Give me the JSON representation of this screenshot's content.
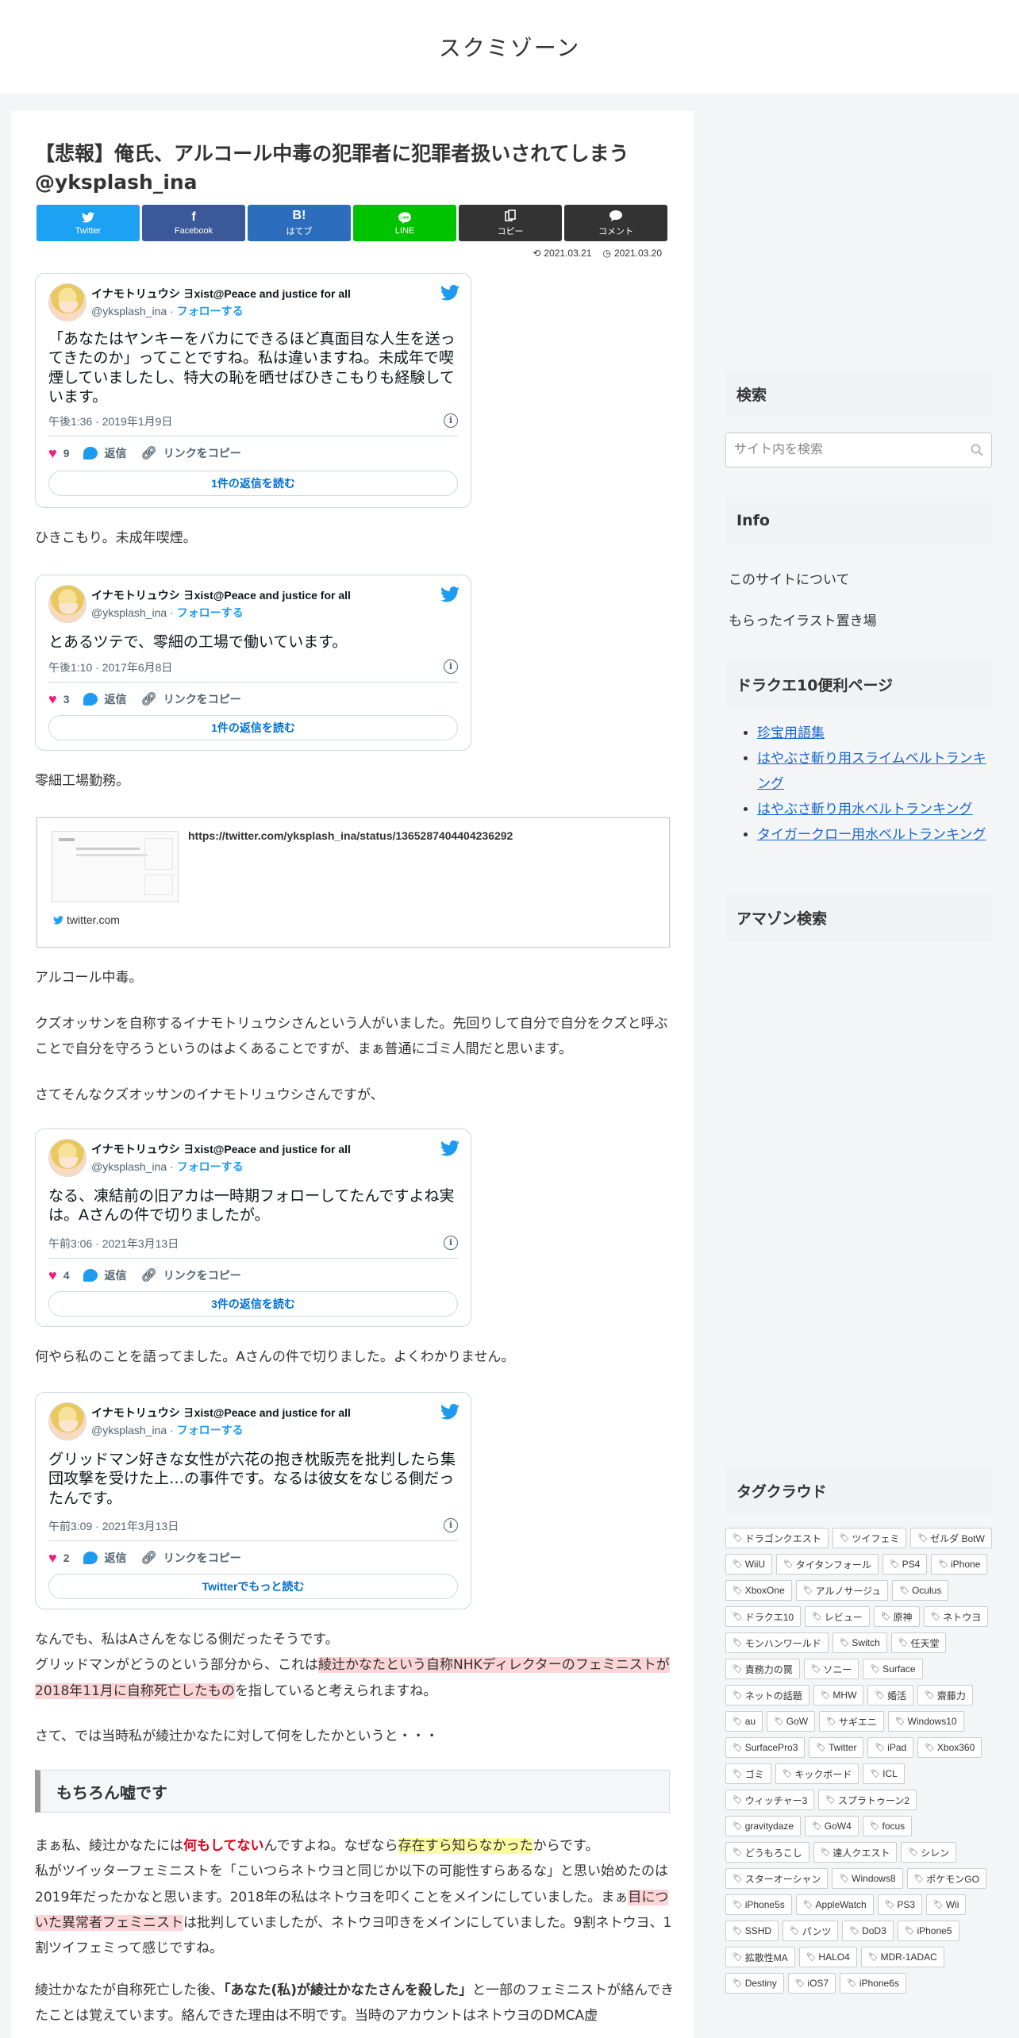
{
  "site": {
    "title": "スクミゾーン"
  },
  "article": {
    "title": "【悲報】俺氏、アルコール中毒の犯罪者に犯罪者扱いされてしまう @yksplash_ina",
    "share": [
      {
        "icon": "twitter-icon",
        "glyph": "🐦",
        "label": "Twitter",
        "color": "#1da1f2"
      },
      {
        "icon": "facebook-icon",
        "glyph": "f",
        "label": "Facebook",
        "color": "#3b5998"
      },
      {
        "icon": "hatena-icon",
        "glyph": "B!",
        "label": "はてブ",
        "color": "#2c6ebd"
      },
      {
        "icon": "line-icon",
        "glyph": "LINE",
        "label": "LINE",
        "color": "#00c300"
      },
      {
        "icon": "copy-icon",
        "glyph": "⎘",
        "label": "コピー",
        "color": "#333333"
      },
      {
        "icon": "comment-icon",
        "glyph": "💬",
        "label": "コメント",
        "color": "#333333"
      }
    ],
    "updated": "2021.03.21",
    "published": "2021.03.20",
    "tweets": [
      {
        "name": "イナモトリュウシ ∃xist@Peace and justice for all",
        "handle": "@yksplash_ina",
        "follow": "フォローする",
        "text": "「あなたはヤンキーをバカにできるほど真面目な人生を送ってきたのか」ってことですね。私は違いますね。未成年で喫煙していましたし、特大の恥を晒せばひきこもりも経験しています。",
        "time": "午後1:36 · 2019年1月9日",
        "likes": "9",
        "reply": "返信",
        "copy_link": "リンクをコピー",
        "read": "1件の返信を読む"
      },
      {
        "name": "イナモトリュウシ ∃xist@Peace and justice for all",
        "handle": "@yksplash_ina",
        "follow": "フォローする",
        "text": "とあるツテで、零細の工場で働いています。",
        "time": "午後1:10 · 2017年6月8日",
        "likes": "3",
        "reply": "返信",
        "copy_link": "リンクをコピー",
        "read": "1件の返信を読む"
      },
      {
        "name": "イナモトリュウシ ∃xist@Peace and justice for all",
        "handle": "@yksplash_ina",
        "follow": "フォローする",
        "text": "なる、凍結前の旧アカは一時期フォローしてたんですよね実は。Aさんの件で切りましたが。",
        "time": "午前3:06 · 2021年3月13日",
        "likes": "4",
        "reply": "返信",
        "copy_link": "リンクをコピー",
        "read": "3件の返信を読む"
      },
      {
        "name": "イナモトリュウシ ∃xist@Peace and justice for all",
        "handle": "@yksplash_ina",
        "follow": "フォローする",
        "text": "グリッドマン好きな女性が六花の抱き枕販売を批判したら集団攻撃を受けた上…の事件です。なるは彼女をなじる側だったんです。",
        "time": "午前3:09 · 2021年3月13日",
        "likes": "2",
        "reply": "返信",
        "copy_link": "リンクをコピー",
        "read": "Twitterでもっと読む"
      }
    ],
    "p1": "ひきこもり。未成年喫煙。",
    "p2": "零細工場勤務。",
    "link_card": {
      "url": "https://twitter.com/yksplash_ina/status/1365287404404236292",
      "site": "twitter.com"
    },
    "p3": "アルコール中毒。",
    "p4": "クズオッサンを自称するイナモトリュウシさんという人がいました。先回りして自分で自分をクズと呼ぶことで自分を守ろうというのはよくあることですが、まぁ普通にゴミ人間だと思います。",
    "p5": "さてそんなクズオッサンのイナモトリュウシさんですが、",
    "p6": "何やら私のことを語ってました。Aさんの件で切りました。よくわかりません。",
    "p7a": "なんでも、私はAさんをなじる側だったそうです。",
    "p7b_pre": "グリッドマンがどうのという部分から、これは",
    "p7b_hl": "綾辻かなたという自称NHKディレクターのフェミニストが2018年11月に自称死亡したもの",
    "p7b_post": "を指していると考えられますね。",
    "p8": "さて、では当時私が綾辻かなたに対して何をしたかというと・・・",
    "h2": "もちろん嘘です",
    "p9_1": "まぁ私、綾辻かなたには",
    "p9_red": "何もしてない",
    "p9_2": "んですよね。なぜなら",
    "p9_hl": "存在すら知らなかった",
    "p9_3": "からです。",
    "p9_4": "私がツイッターフェミニストを「こいつらネトウヨと同じか以下の可能性すらあるな」と思い始めたのは2019年だったかなと思います。2018年の私はネトウヨを叩くことをメインにしていました。まぁ",
    "p9_hl2": "目についた異常者フェミニスト",
    "p9_5": "は批判していましたが、ネトウヨ叩きをメインにしていました。9割ネトウヨ、1割ツイフェミって感じですね。",
    "p10_1": "綾辻かなたが自称死亡した後、",
    "p10_bold": "「あなた(私)が綾辻かなたさんを殺した」",
    "p10_2": "と一部のフェミニストが絡んできたことは覚えています。絡んできた理由は不明です。当時のアカウントはネトウヨのDMCA虚"
  },
  "sidebar": {
    "search_heading": "検索",
    "search_placeholder": "サイト内を検索",
    "info_heading": "Info",
    "info_links": [
      "このサイトについて",
      "もらったイラスト置き場"
    ],
    "dq_heading": "ドラクエ10便利ページ",
    "dq_links": [
      "珍宝用語集",
      "はやぶさ斬り用スライムベルトランキング",
      "はやぶさ斬り用水ベルトランキング",
      "タイガークロー用水ベルトランキング"
    ],
    "amazon_heading": "アマゾン検索",
    "tag_heading": "タグクラウド",
    "tags": [
      "ドラゴンクエスト",
      "ツイフェミ",
      "ゼルダ BotW",
      "WiiU",
      "タイタンフォール",
      "PS4",
      "iPhone",
      "XboxOne",
      "アルノサージュ",
      "Oculus",
      "ドラクエ10",
      "レビュー",
      "原神",
      "ネトウヨ",
      "モンハンワールド",
      "Switch",
      "任天堂",
      "責務力の罠",
      "ソニー",
      "Surface",
      "ネットの話題",
      "MHW",
      "婚活",
      "齋藤力",
      "au",
      "GoW",
      "サギエニ",
      "Windows10",
      "SurfacePro3",
      "Twitter",
      "iPad",
      "Xbox360",
      "ゴミ",
      "キックボード",
      "ICL",
      "ウィッチャー3",
      "スプラトゥーン2",
      "gravitydaze",
      "GoW4",
      "focus",
      "どうもろこし",
      "達人クエスト",
      "シレン",
      "スターオーシャン",
      "Windows8",
      "ポケモンGO",
      "iPhone5s",
      "AppleWatch",
      "PS3",
      "Wii",
      "SSHD",
      "パンツ",
      "DoD3",
      "iPhone5",
      "拡散性MA",
      "HALO4",
      "MDR-1ADAC",
      "Destiny",
      "iOS7",
      "iPhone6s"
    ]
  }
}
